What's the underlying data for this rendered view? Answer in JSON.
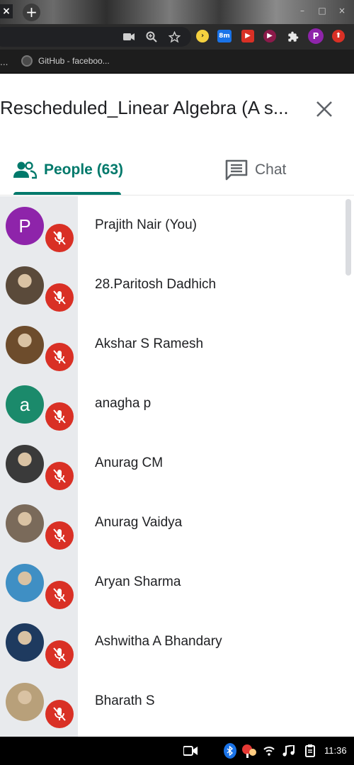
{
  "browser": {
    "close_tab_glyph": "×",
    "new_tab_glyph": "+",
    "window_buttons": [
      "–",
      "□",
      "×"
    ],
    "extensions": [
      {
        "name": "yellow-ext-icon",
        "label": "›",
        "color": "#f4d03f",
        "fg": "#222"
      },
      {
        "name": "badge-ext-icon",
        "label": "8m",
        "color": "#1a73e8",
        "fg": "#fff"
      },
      {
        "name": "red-square-ext-icon",
        "label": "▶",
        "color": "#d93025",
        "fg": "#fff"
      },
      {
        "name": "record-ext-icon",
        "label": "▶",
        "color": "#8b1a4a",
        "fg": "#fff"
      },
      {
        "name": "puzzle-icon",
        "label": "",
        "color": "transparent",
        "fg": "#fff"
      },
      {
        "name": "profile-avatar-icon",
        "label": "P",
        "color": "#8e24aa",
        "fg": "#fff"
      },
      {
        "name": "update-icon",
        "label": "⬆",
        "color": "#d93025",
        "fg": "#fff"
      }
    ],
    "bookmark": {
      "dot": "...",
      "label": "GitHub - faceboo..."
    }
  },
  "meeting": {
    "title": "Rescheduled_Linear Algebra (A s...",
    "tabs": {
      "people_label": "People (63)",
      "chat_label": "Chat",
      "active": "people",
      "accent": "#00796b"
    }
  },
  "participants": [
    {
      "name": "Prajith Nair (You)",
      "avatar_letter": "P",
      "avatar_color": "#8e24aa",
      "photo": false
    },
    {
      "name": "28.Paritosh Dadhich",
      "avatar_letter": "",
      "avatar_color": "#5a4a3a",
      "photo": true
    },
    {
      "name": "Akshar S Ramesh",
      "avatar_letter": "",
      "avatar_color": "#6d4c2c",
      "photo": true
    },
    {
      "name": "anagha p",
      "avatar_letter": "a",
      "avatar_color": "#1b8a6b",
      "photo": false
    },
    {
      "name": "Anurag CM",
      "avatar_letter": "",
      "avatar_color": "#3a3a3a",
      "photo": true
    },
    {
      "name": "Anurag Vaidya",
      "avatar_letter": "",
      "avatar_color": "#7a6a5a",
      "photo": true
    },
    {
      "name": "Aryan Sharma",
      "avatar_letter": "",
      "avatar_color": "#3f8fc4",
      "photo": true
    },
    {
      "name": "Ashwitha A Bhandary",
      "avatar_letter": "",
      "avatar_color": "#1e3a5f",
      "photo": true
    },
    {
      "name": "Bharath S",
      "avatar_letter": "",
      "avatar_color": "#b8a07a",
      "photo": true
    }
  ],
  "shelf": {
    "time": "11:36",
    "icons": [
      "video-icon",
      "bluetooth-icon",
      "notification-icon",
      "wifi-icon",
      "music-icon",
      "clipboard-icon"
    ]
  }
}
